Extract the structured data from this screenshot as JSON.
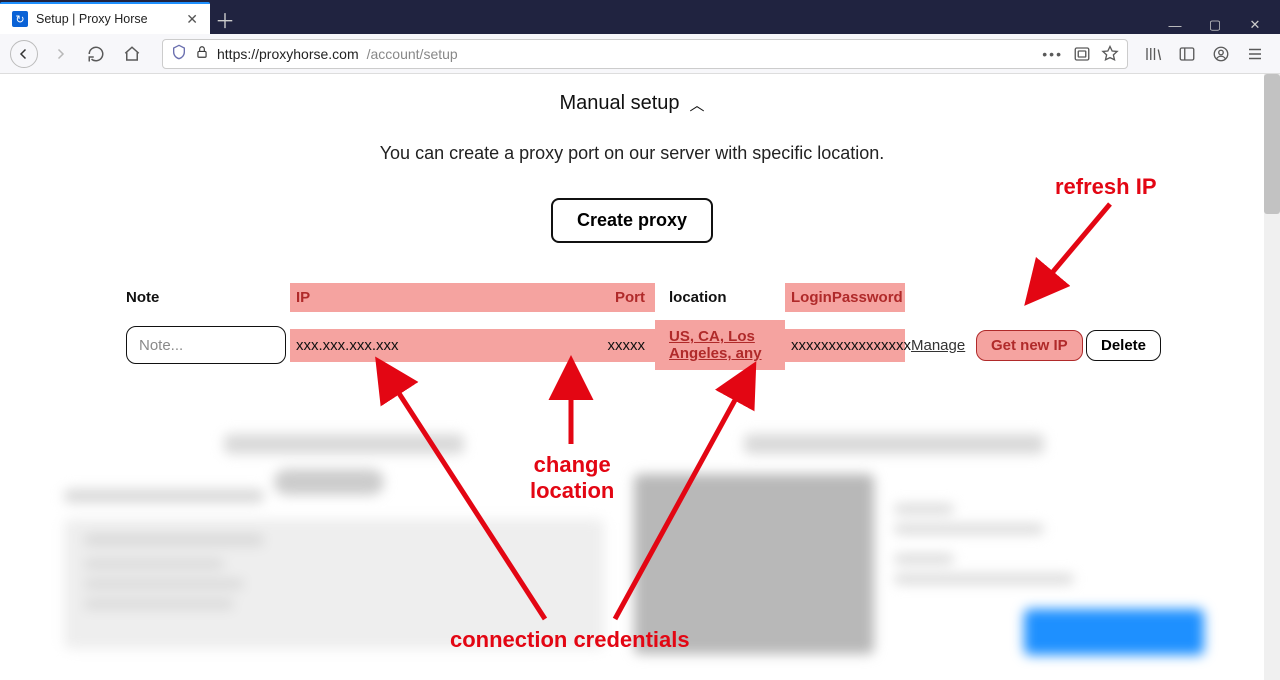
{
  "browser": {
    "tab_title": "Setup | Proxy Horse",
    "url_host": "https://proxyhorse.com",
    "url_path": "/account/setup"
  },
  "page": {
    "section_title": "Manual setup",
    "subtitle": "You can create a proxy port on our server with specific location.",
    "create_label": "Create proxy"
  },
  "headers": {
    "note": "Note",
    "ip": "IP",
    "port": "Port",
    "location": "location",
    "login": "Login",
    "password": "Password"
  },
  "row": {
    "note_placeholder": "Note...",
    "ip": "xxx.xxx.xxx.xxx",
    "port": "xxxxx",
    "location": "US, CA, Los Angeles, any",
    "login": "xxxxxxxx",
    "password": "xxxxxxxx",
    "manage": "Manage",
    "get_new_ip": "Get new IP",
    "delete": "Delete"
  },
  "annotations": {
    "refresh_ip": "refresh IP",
    "change_location_l1": "change",
    "change_location_l2": "location",
    "connection_credentials": "connection credentials"
  }
}
